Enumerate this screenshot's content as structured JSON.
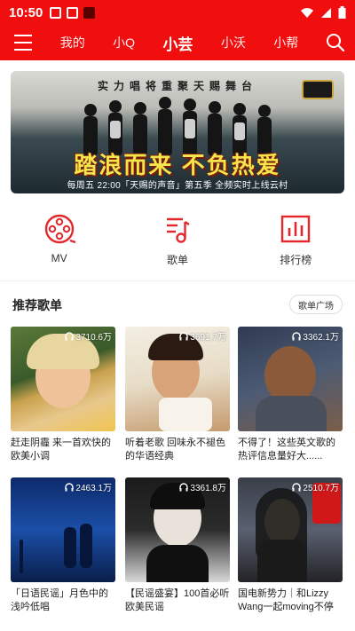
{
  "status_bar": {
    "time": "10:50"
  },
  "nav": {
    "tabs": [
      "我的",
      "小Q",
      "小芸",
      "小沃",
      "小帮"
    ],
    "active_index": 2
  },
  "banner": {
    "headline_top": "实力唱将重聚天赐舞台",
    "headline": "踏浪而来 不负热爱",
    "footer": "每周五 22:00「天赐的声音」第五季 全频实时上线云村"
  },
  "quick_entries": [
    {
      "label": "MV",
      "icon": "mv-film-reel-icon"
    },
    {
      "label": "歌单",
      "icon": "playlist-music-note-icon"
    },
    {
      "label": "排行榜",
      "icon": "chart-bars-icon"
    }
  ],
  "section": {
    "title": "推荐歌单",
    "more_button": "歌单广场"
  },
  "playlists": [
    {
      "plays": "3710.6万",
      "title": "赶走阴霾 来一首欢快的欧美小调"
    },
    {
      "plays": "3691.7万",
      "title": "听着老歌 回味永不褪色的华语经典"
    },
    {
      "plays": "3362.1万",
      "title": "不得了！这些英文歌的热评信息量好大......"
    },
    {
      "plays": "2463.1万",
      "title": "「日语民谣」月色中的浅吟低唱"
    },
    {
      "plays": "3361.8万",
      "title": "【民谣盛宴】100首必听欧美民谣"
    },
    {
      "plays": "2510.7万",
      "title": "国电新势力｜和Lizzy Wang一起moving不停"
    }
  ],
  "colors": {
    "brand_red": "#f10e0e",
    "icon_red": "#e3282d"
  }
}
